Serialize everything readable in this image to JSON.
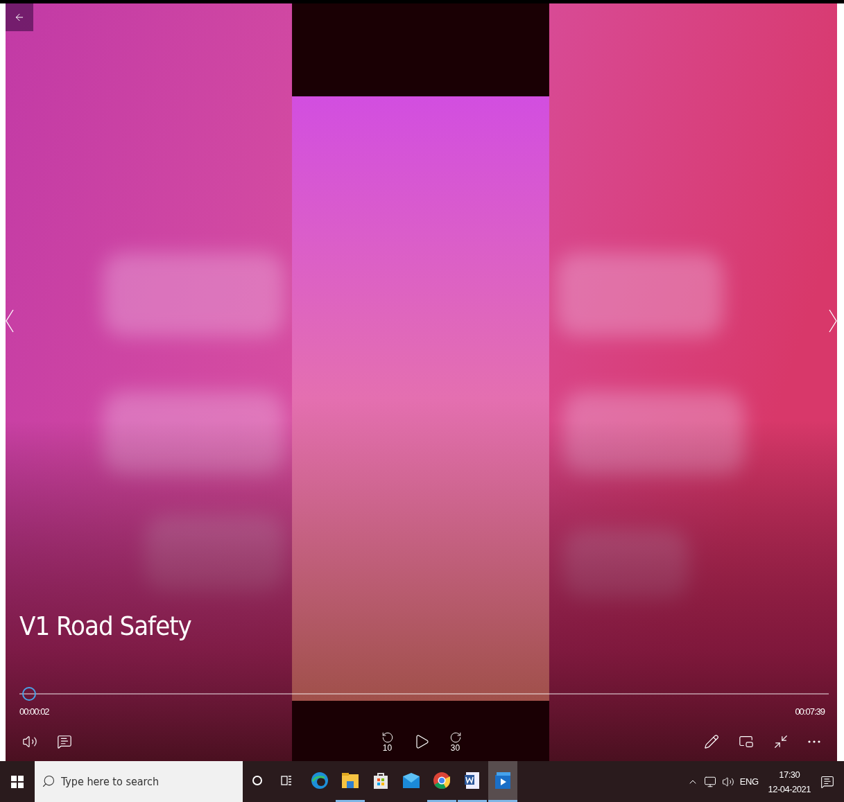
{
  "player": {
    "title": "V1 Road Safety",
    "seek": {
      "level": 0.005
    },
    "elapsed": "00:00:02",
    "duration": "00:07:39",
    "skip_back": "10",
    "skip_forward": "30"
  },
  "taskbar": {
    "search": {
      "placeholder": "Type here to search"
    },
    "apps": [
      {
        "kind": "edge",
        "running": false,
        "selected": false
      },
      {
        "kind": "files",
        "running": true,
        "selected": false
      },
      {
        "kind": "store",
        "running": false,
        "selected": false
      },
      {
        "kind": "mail",
        "running": false,
        "selected": false
      },
      {
        "kind": "chrome",
        "running": true,
        "selected": false
      },
      {
        "kind": "word",
        "running": true,
        "selected": false
      },
      {
        "kind": "movies",
        "running": true,
        "selected": true
      }
    ],
    "tray": {
      "language": "ENG",
      "time": "17:30",
      "date": "12-04-2021"
    }
  }
}
